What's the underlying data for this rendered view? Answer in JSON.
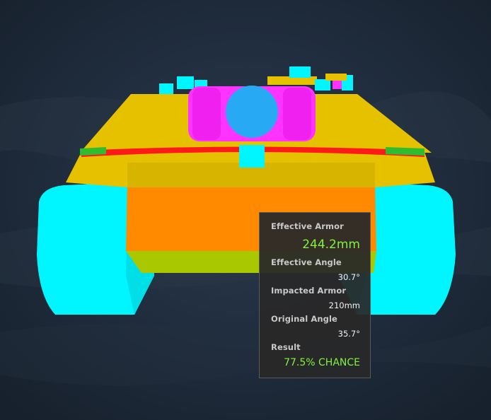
{
  "scene": {
    "background_color": "#1b2736",
    "armor_colors": {
      "very_thick": "#ff33ff",
      "thick": "#e5c100",
      "medium": "#ff8a00",
      "thin": "#a9c800",
      "spaced_tracks": "#00f6ff",
      "weak_gun": "#27a9f4",
      "critical": "#ff1a1a"
    }
  },
  "tooltip": {
    "effective_armor_label": "Effective Armor",
    "effective_armor_value": "244.2mm",
    "effective_angle_label": "Effective Angle",
    "effective_angle_value": "30.7°",
    "impacted_armor_label": "Impacted Armor",
    "impacted_armor_value": "210mm",
    "original_angle_label": "Original Angle",
    "original_angle_value": "35.7°",
    "result_label": "Result",
    "result_value": "77.5% CHANCE",
    "highlight_color": "#7ff33c"
  }
}
